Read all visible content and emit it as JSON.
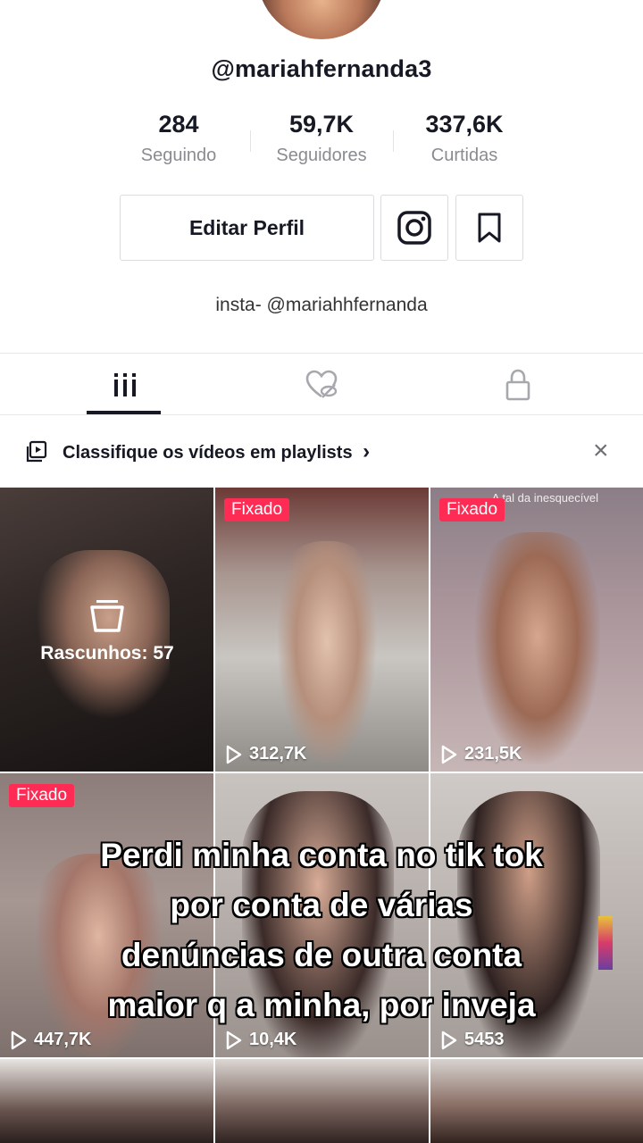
{
  "profile": {
    "username": "@mariahfernanda3",
    "bio": "insta- @mariahhfernanda"
  },
  "stats": [
    {
      "value": "284",
      "label": "Seguindo"
    },
    {
      "value": "59,7K",
      "label": "Seguidores"
    },
    {
      "value": "337,6K",
      "label": "Curtidas"
    }
  ],
  "actions": {
    "edit_label": "Editar Perfil",
    "instagram_icon": "instagram-icon",
    "bookmark_icon": "bookmark-icon"
  },
  "tabs": [
    {
      "icon": "grid-icon",
      "active": true
    },
    {
      "icon": "liked-hidden-icon",
      "active": false
    },
    {
      "icon": "lock-icon",
      "active": false
    }
  ],
  "banner": {
    "text": "Classifique os vídeos em playlists",
    "chevron": "›",
    "close": "×"
  },
  "videos": [
    {
      "type": "drafts",
      "label": "Rascunhos: 57"
    },
    {
      "pinned": true,
      "pinned_label": "Fixado",
      "views": "312,7K"
    },
    {
      "pinned": true,
      "pinned_label": "Fixado",
      "views": "231,5K",
      "caption": "A tal da inesquecível"
    },
    {
      "pinned": true,
      "pinned_label": "Fixado",
      "views": "447,7K"
    },
    {
      "pinned": false,
      "views": "10,4K"
    },
    {
      "pinned": false,
      "views": "5453"
    }
  ],
  "overlay": {
    "lines": [
      "Perdi minha conta no tik tok",
      "por conta de várias",
      "denúncias de outra conta",
      "maior q a minha, por inveja"
    ]
  },
  "colors": {
    "accent": "#fe2c55",
    "text": "#161823",
    "muted": "#8a8b91"
  }
}
